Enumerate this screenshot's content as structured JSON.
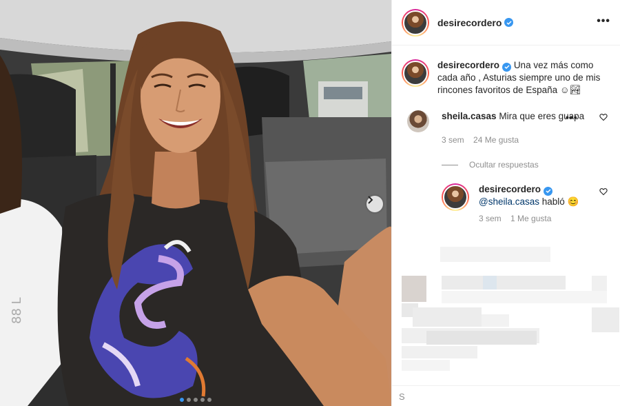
{
  "post": {
    "username": "desirecordero",
    "caption": "Una vez más como cada año , Asturias siempre uno de mis rincones favoritos de España ☺︎🏞",
    "carousel_count": 5,
    "carousel_active_index": 1
  },
  "comments": [
    {
      "username": "sheila.casas",
      "text": "Mira que eres guapa",
      "age": "3 sem",
      "likes": "24 Me gusta"
    }
  ],
  "hide_replies_label": "Ocultar respuestas",
  "reply": {
    "username": "desirecordero",
    "mention": "@sheila.casas",
    "text": "habló 😊",
    "age": "3 sem",
    "likes": "1 Me gusta"
  },
  "add_comment_placeholder": "S",
  "colors": {
    "verified": "#3897f0",
    "border": "#efefef",
    "secondary_text": "#8e8e8e",
    "mention": "#00376b"
  },
  "icons": [
    "verified-badge-icon",
    "more-options-icon",
    "heart-icon",
    "chevron-right-icon"
  ]
}
